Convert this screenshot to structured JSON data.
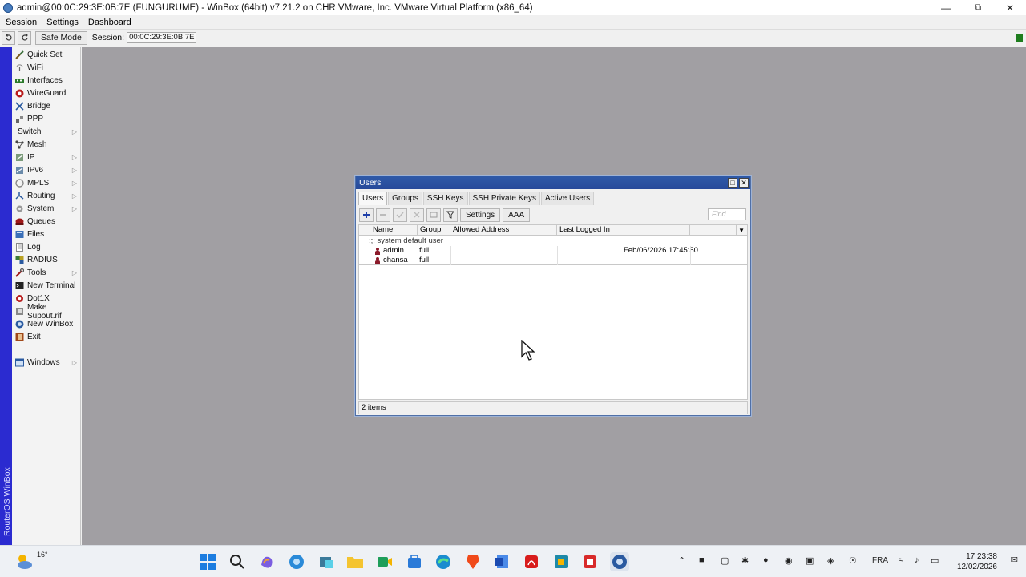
{
  "window": {
    "title": "admin@00:0C:29:3E:0B:7E (FUNGURUME) - WinBox (64bit) v7.21.2 on CHR VMware, Inc. VMware Virtual Platform (x86_64)"
  },
  "menu": [
    "Session",
    "Settings",
    "Dashboard"
  ],
  "toolbar": {
    "safe_mode_label": "Safe Mode",
    "session_label": "Session:",
    "session_value": "00:0C:29:3E:0B:7E"
  },
  "side_brand": "RouterOS WinBox",
  "sidebar": {
    "items": [
      {
        "label": "Quick Set",
        "icon": "quick-set-icon"
      },
      {
        "label": "WiFi",
        "icon": "wifi-icon"
      },
      {
        "label": "Interfaces",
        "icon": "interfaces-icon"
      },
      {
        "label": "WireGuard",
        "icon": "wireguard-icon"
      },
      {
        "label": "Bridge",
        "icon": "bridge-icon"
      },
      {
        "label": "PPP",
        "icon": "ppp-icon"
      },
      {
        "label": "Switch",
        "icon": ""
      },
      {
        "label": "Mesh",
        "icon": "mesh-icon"
      },
      {
        "label": "IP",
        "icon": "ip-icon"
      },
      {
        "label": "IPv6",
        "icon": "ipv6-icon"
      },
      {
        "label": "MPLS",
        "icon": "mpls-icon"
      },
      {
        "label": "Routing",
        "icon": "routing-icon"
      },
      {
        "label": "System",
        "icon": "system-icon"
      },
      {
        "label": "Queues",
        "icon": "queues-icon"
      },
      {
        "label": "Files",
        "icon": "files-icon"
      },
      {
        "label": "Log",
        "icon": "log-icon"
      },
      {
        "label": "RADIUS",
        "icon": "radius-icon"
      },
      {
        "label": "Tools",
        "icon": "tools-icon"
      },
      {
        "label": "New Terminal",
        "icon": "terminal-icon"
      },
      {
        "label": "Dot1X",
        "icon": "dot1x-icon"
      },
      {
        "label": "Make Supout.rif",
        "icon": "supout-icon"
      },
      {
        "label": "New WinBox",
        "icon": "winbox-icon"
      },
      {
        "label": "Exit",
        "icon": "exit-icon"
      },
      {
        "label": "Windows",
        "icon": "windows-icon"
      }
    ]
  },
  "users_window": {
    "title": "Users",
    "tabs": [
      "Users",
      "Groups",
      "SSH Keys",
      "SSH Private Keys",
      "Active Users"
    ],
    "buttons": {
      "settings": "Settings",
      "aaa": "AAA"
    },
    "find_placeholder": "Find",
    "columns": [
      "Name",
      "Group",
      "Allowed Address",
      "Last Logged In"
    ],
    "comment_row": ";;; system default user",
    "rows": [
      {
        "name": "admin",
        "group": "full",
        "allowed_address": "",
        "last_logged_in": "Feb/06/2026 17:45:50"
      },
      {
        "name": "chansa",
        "group": "full",
        "allowed_address": "",
        "last_logged_in": ""
      }
    ],
    "status": "2 items"
  },
  "taskbar": {
    "temperature": "16°",
    "language": "FRA",
    "time": "17:23:38",
    "date": "12/02/2026"
  },
  "colors": {
    "desktop": "#a19fa3",
    "side_strip": "#2b2bd0",
    "window_title": "#2f5aa8",
    "user_icon": "#8b1a2a"
  }
}
